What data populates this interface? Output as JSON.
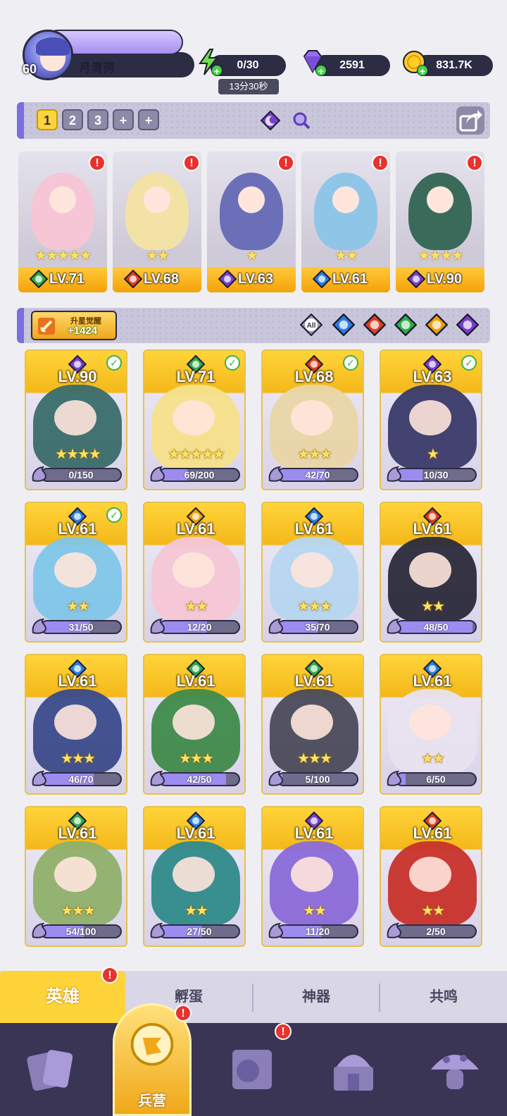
{
  "player": {
    "name": "月清荷",
    "level": "60"
  },
  "resources": {
    "stamina": "0/30",
    "stamina_timer": "13分30秒",
    "gems": "2591",
    "gold": "831.7K"
  },
  "team_slots": [
    "1",
    "2",
    "3",
    "+",
    "+"
  ],
  "active_slot": "1",
  "team": [
    {
      "level": "LV.71",
      "stars": "★★★★★",
      "element": "wind",
      "alert": "!"
    },
    {
      "level": "LV.68",
      "stars": "★★",
      "element": "fire",
      "alert": "!"
    },
    {
      "level": "LV.63",
      "stars": "★",
      "element": "dark",
      "alert": "!"
    },
    {
      "level": "LV.61",
      "stars": "★★",
      "element": "water",
      "alert": "!"
    },
    {
      "level": "LV.90",
      "stars": "★★★★",
      "element": "dark",
      "alert": "!"
    }
  ],
  "awaken": {
    "label": "升星觉醒",
    "value": "+1424"
  },
  "filters": {
    "all_label": "All",
    "elements": [
      "water",
      "fire",
      "wind",
      "light",
      "dark"
    ]
  },
  "heroes": [
    {
      "level": "LV.90",
      "element": "dark",
      "checked": true,
      "stars": "★★★★",
      "shards": "0/150",
      "fill": 0
    },
    {
      "level": "LV.71",
      "element": "wind",
      "checked": true,
      "stars": "★★★★★",
      "shards": "69/200",
      "fill": 0.345
    },
    {
      "level": "LV.68",
      "element": "fire",
      "checked": true,
      "stars": "★★★",
      "shards": "42/70",
      "fill": 0.6
    },
    {
      "level": "LV.63",
      "element": "dark",
      "checked": true,
      "stars": "★",
      "shards": "10/30",
      "fill": 0.333
    },
    {
      "level": "LV.61",
      "element": "water",
      "checked": true,
      "stars": "★★",
      "shards": "31/50",
      "fill": 0.62
    },
    {
      "level": "LV.61",
      "element": "light",
      "checked": false,
      "stars": "★★",
      "shards": "12/20",
      "fill": 0.6
    },
    {
      "level": "LV.61",
      "element": "water",
      "checked": false,
      "stars": "★★★",
      "shards": "35/70",
      "fill": 0.5
    },
    {
      "level": "LV.61",
      "element": "fire",
      "checked": false,
      "stars": "★★",
      "shards": "48/50",
      "fill": 0.96
    },
    {
      "level": "LV.61",
      "element": "water",
      "checked": false,
      "stars": "★★★",
      "shards": "46/70",
      "fill": 0.657
    },
    {
      "level": "LV.61",
      "element": "wind",
      "checked": false,
      "stars": "★★★",
      "shards": "42/50",
      "fill": 0.84
    },
    {
      "level": "LV.61",
      "element": "wind",
      "checked": false,
      "stars": "★★★",
      "shards": "5/100",
      "fill": 0.05
    },
    {
      "level": "LV.61",
      "element": "water",
      "checked": false,
      "stars": "★★",
      "shards": "6/50",
      "fill": 0.12
    },
    {
      "level": "LV.61",
      "element": "wind",
      "checked": false,
      "stars": "★★★",
      "shards": "54/100",
      "fill": 0.54
    },
    {
      "level": "LV.61",
      "element": "water",
      "checked": false,
      "stars": "★★",
      "shards": "27/50",
      "fill": 0.54
    },
    {
      "level": "LV.61",
      "element": "dark",
      "checked": false,
      "stars": "★★",
      "shards": "11/20",
      "fill": 0.55
    },
    {
      "level": "LV.61",
      "element": "fire",
      "checked": false,
      "stars": "★★",
      "shards": "2/50",
      "fill": 0.04
    }
  ],
  "sub_tabs": [
    "英雄",
    "孵蛋",
    "神器",
    "共鸣"
  ],
  "nav": {
    "active_label": "兵营",
    "items": [
      "cards-icon",
      "barracks-icon",
      "map-icon",
      "temple-icon",
      "mushroom-icon"
    ]
  },
  "colors": {
    "wind": "#2fae4a",
    "fire": "#e0401c",
    "dark": "#7a3fd0",
    "water": "#2a7fe0",
    "light": "#f0a000"
  }
}
